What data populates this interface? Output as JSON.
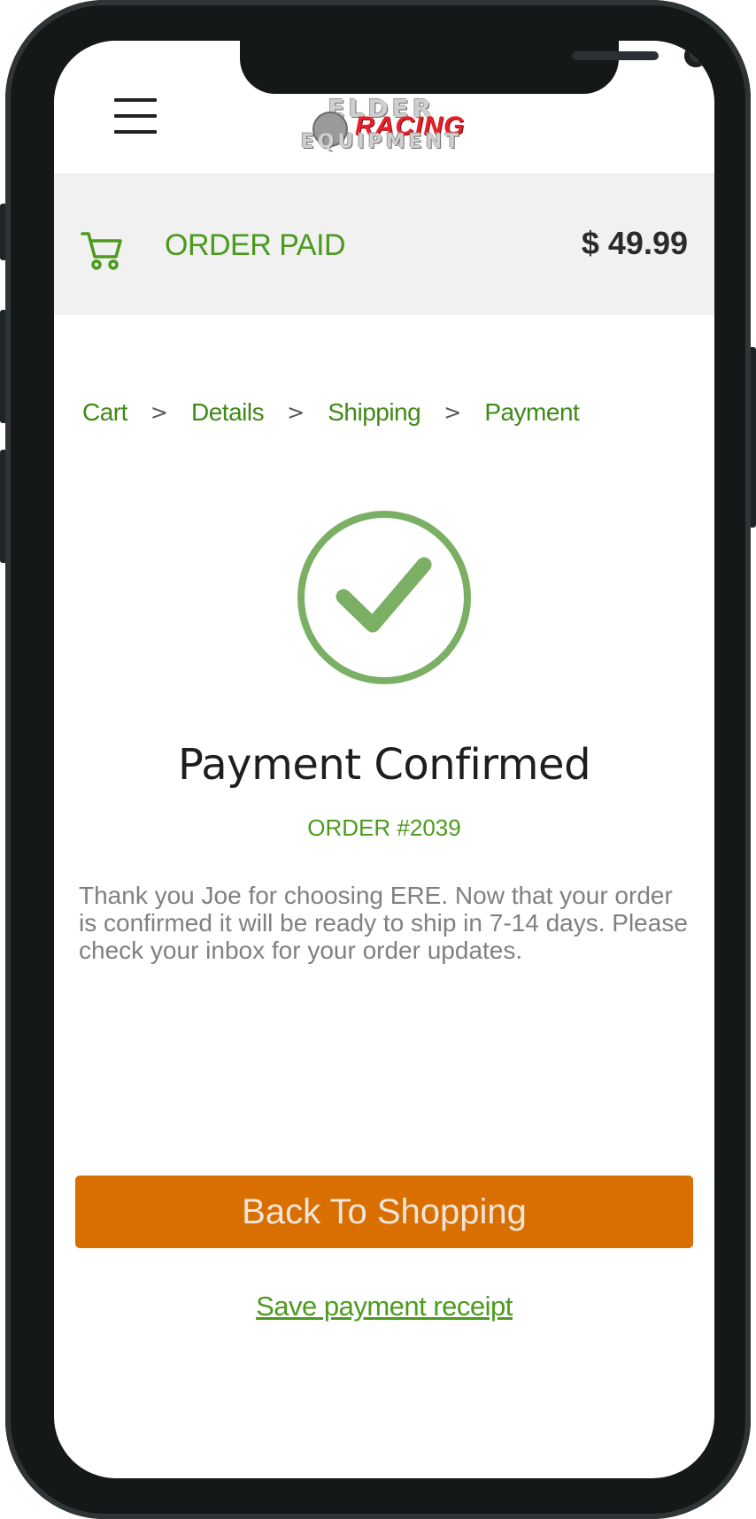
{
  "header": {
    "menu_icon": "hamburger-menu-icon",
    "logo": {
      "top": "ELDER",
      "middle": "RACING",
      "bottom": "EQUIPMENT"
    }
  },
  "order_bar": {
    "cart_icon": "cart-icon",
    "status": "ORDER PAID",
    "total": "$ 49.99"
  },
  "breadcrumb": {
    "items": [
      "Cart",
      "Details",
      "Shipping",
      "Payment"
    ],
    "separator": ">"
  },
  "confirmation": {
    "icon": "check-circle-icon",
    "title": "Payment Confirmed",
    "order_number": "ORDER #2039",
    "message": "Thank you Joe for choosing ERE. Now that your order is confirmed it will be ready to ship in 7-14 days. Please check your inbox for your order updates."
  },
  "actions": {
    "primary_label": "Back To Shopping",
    "secondary_link": "Save payment receipt"
  },
  "colors": {
    "accent_green": "#4c9a1e",
    "check_green": "#7aaf64",
    "button_orange": "#d96f00",
    "phone_frame": "#141819"
  }
}
